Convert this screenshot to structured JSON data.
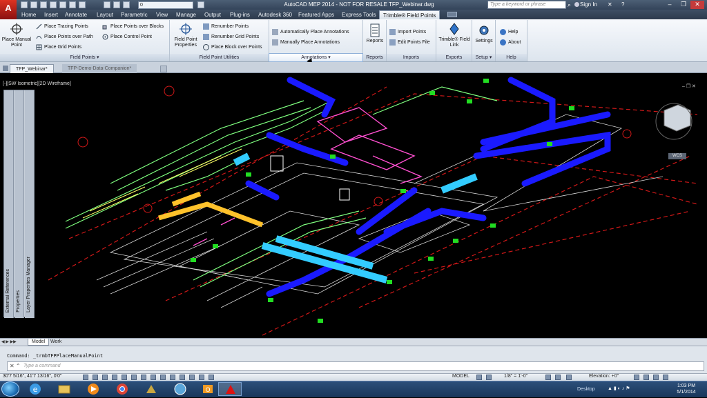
{
  "app": {
    "logo": "A",
    "title": "AutoCAD MEP 2014 - NOT FOR RESALE    TFP_Webinar.dwg",
    "workspace": "0"
  },
  "search": {
    "placeholder": "Type a keyword or phrase"
  },
  "user": {
    "signin": "Sign In"
  },
  "ribbon_tabs": [
    "Home",
    "Insert",
    "Annotate",
    "Layout",
    "Parametric",
    "View",
    "Manage",
    "Output",
    "Plug-ins",
    "Autodesk 360",
    "Featured Apps",
    "Express Tools",
    "Trimble® Field Points"
  ],
  "ribbon": {
    "field_points": {
      "label": "Field Points ▾",
      "place_manual": "Place Manual Point",
      "place_tracing": "Place Tracing Points",
      "place_over_path": "Place Points over Path",
      "place_grid": "Place Grid Points",
      "place_over_blocks": "Place Points over Blocks",
      "place_control": "Place Control Point"
    },
    "utilities": {
      "label": "Field Point Utilities",
      "properties": "Field Point Properties",
      "renumber": "Renumber Points",
      "renumber_grid": "Renumber Grid Points",
      "place_block": "Place Block over Points"
    },
    "annotations": {
      "label": "Annotations ▾",
      "auto": "Automatically Place Annotations",
      "manual": "Manually Place Annotations"
    },
    "reports": {
      "label": "Reports",
      "btn": "Reports"
    },
    "imports": {
      "label": "Imports",
      "import": "Import Points",
      "edit": "Edit Points File"
    },
    "exports": {
      "label": "Exports",
      "link": "Trimble® Field Link"
    },
    "setup": {
      "label": "Setup ▾",
      "settings": "Settings"
    },
    "help": {
      "label": "Help",
      "help": "Help",
      "about": "About"
    }
  },
  "doc_tabs": [
    "TFP_Webinar*",
    "TFP-Demo-Data-Companion*"
  ],
  "viewport": {
    "label": "[-][SW Isometric][2D Wireframe]",
    "wcs": "WCS"
  },
  "palette": {
    "labels": [
      "External References",
      "Properties",
      "Layer Properties Manager"
    ]
  },
  "layout_tabs": [
    "Model",
    "Work"
  ],
  "command": {
    "history": "Command: _trmbTFPPlaceManualPoint",
    "placeholder": "Type a command"
  },
  "status": {
    "coords": "30'7 5/16\", 41'7 13/16\", 0'0\"",
    "model": "MODEL",
    "scale": "1/8\" = 1'-0\"",
    "elevation": "Elevation: +0\""
  },
  "taskbar": {
    "desktop": "Desktop",
    "time": "1:03 PM",
    "date": "5/1/2014"
  },
  "colors": {
    "ribbon": "#e6ecf3",
    "duct_blue": "#1a1aff",
    "duct_cyan": "#33ccff",
    "duct_yellow": "#ffc22b",
    "wire_green": "#7fff7f",
    "wire_pink": "#ff4fd0",
    "red_dash": "#d01818"
  }
}
